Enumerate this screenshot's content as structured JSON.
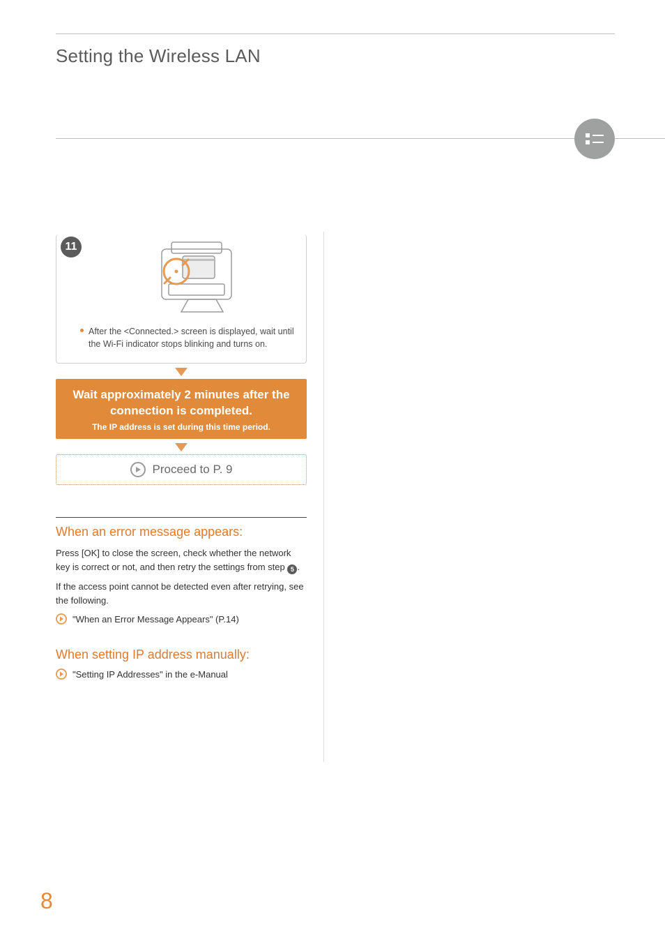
{
  "header": {
    "title": "Setting the Wireless LAN"
  },
  "step": {
    "number": "11",
    "note": "After the <Connected.> screen is displayed, wait until the Wi-Fi indicator stops blinking and turns on."
  },
  "wait_box": {
    "line1": "Wait approximately 2 minutes after the connection is completed.",
    "line2": "The IP address is set during this time period."
  },
  "proceed": {
    "text": "Proceed to P. 9"
  },
  "error_section": {
    "heading": "When an error message appears:",
    "para1_a": "Press [OK] to close the screen, check whether the network key is correct or not, and then retry the settings from step ",
    "para1_badge": "5",
    "para1_b": ".",
    "para2": "If the access point cannot be detected even after retrying, see the following.",
    "ref": "\"When an Error Message Appears\" (P.14)"
  },
  "ip_section": {
    "heading": "When setting IP address manually:",
    "ref": "\"Setting IP Addresses\" in the e-Manual"
  },
  "page_number": "8"
}
